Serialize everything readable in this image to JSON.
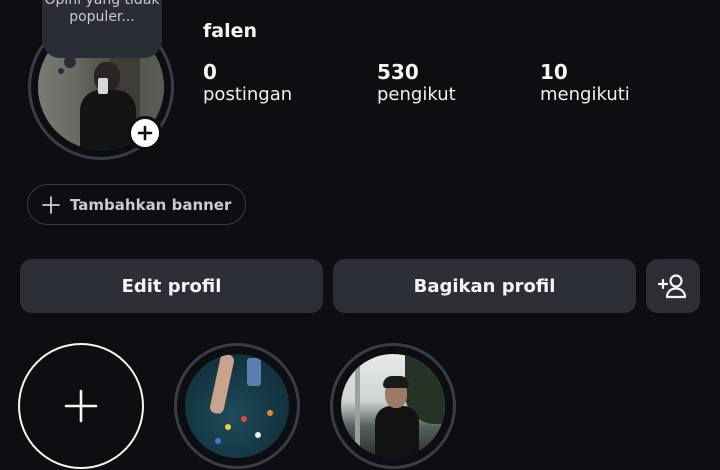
{
  "profile": {
    "username": "falen",
    "note_text": "Opini yang tidak populer..."
  },
  "stats": [
    {
      "value": "0",
      "label": "postingan"
    },
    {
      "value": "530",
      "label": "pengikut"
    },
    {
      "value": "10",
      "label": "mengikuti"
    }
  ],
  "banner": {
    "label": "Tambahkan banner"
  },
  "buttons": {
    "edit_profile": "Edit profil",
    "share_profile": "Bagikan profil"
  },
  "icons": {
    "add_story": "plus-icon",
    "add_banner": "plus-icon",
    "add_user": "person-add-icon",
    "new_highlight": "plus-icon"
  }
}
